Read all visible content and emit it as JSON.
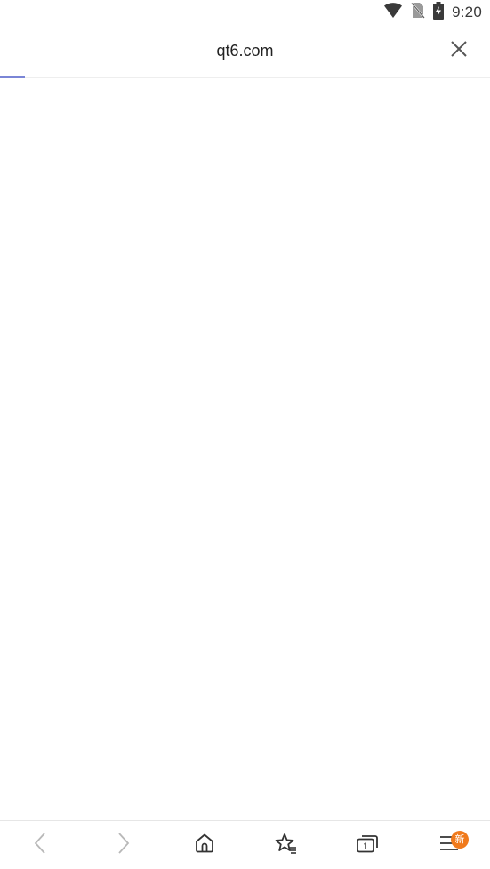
{
  "status_bar": {
    "time": "9:20",
    "icons": [
      "wifi-icon",
      "no-sim-icon",
      "battery-charging-icon"
    ]
  },
  "top_bar": {
    "title": "qt6.com",
    "close_icon": "close-icon",
    "load_progress": 0.05,
    "accent_color": "#7a85d6"
  },
  "bottom_nav": {
    "items": [
      {
        "icon": "back-icon"
      },
      {
        "icon": "forward-icon"
      },
      {
        "icon": "home-icon"
      },
      {
        "icon": "bookmarks-icon"
      },
      {
        "icon": "tabs-icon",
        "count": "1"
      },
      {
        "icon": "menu-icon",
        "badge": "新",
        "badge_color": "#f07a1c"
      }
    ]
  }
}
